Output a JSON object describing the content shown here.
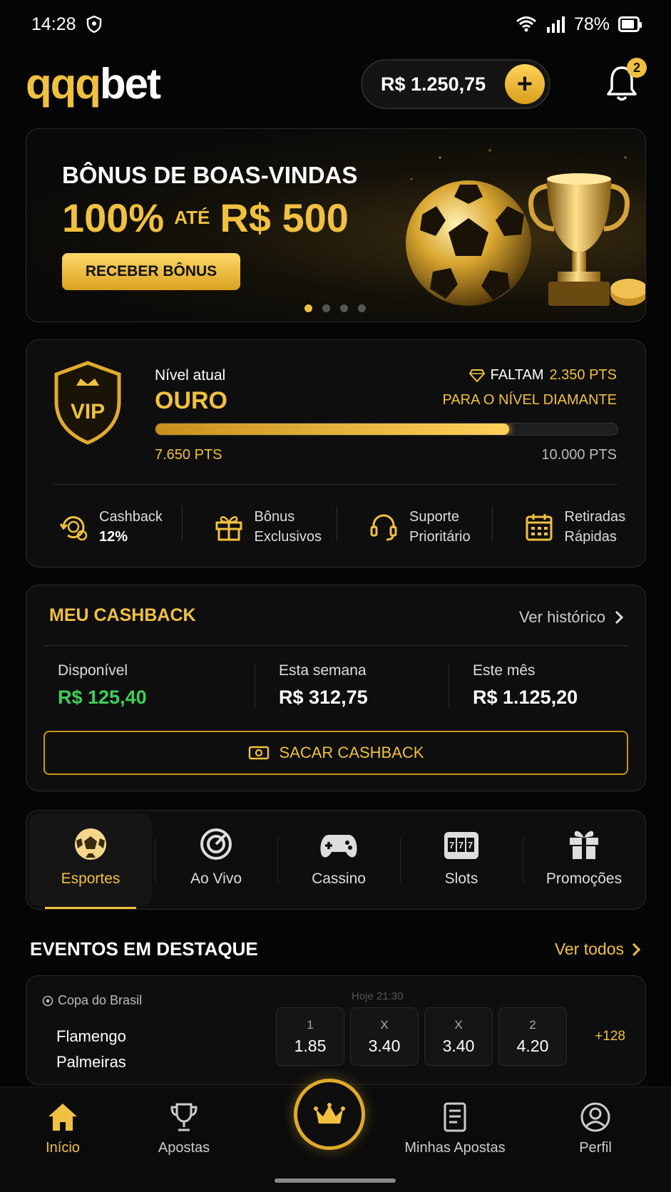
{
  "status": {
    "time": "14:28",
    "battery": "78%"
  },
  "header": {
    "logo_q": "qqq",
    "logo_bet": "bet",
    "balance": "R$ 1.250,75",
    "add_label": "+",
    "notif_count": "2"
  },
  "banner": {
    "title": "BÔNUS DE BOAS-VINDAS",
    "percent": "100%",
    "ate": "ATÉ",
    "amount": "R$ 500",
    "button": "RECEBER BÔNUS",
    "slides": 4,
    "active_slide": 0
  },
  "vip": {
    "badge": "VIP",
    "level_label": "Nível atual",
    "level": "OURO",
    "need_prefix": "FALTAM",
    "need_points": "2.350 PTS",
    "need_suffix": "PARA O NÍVEL DIAMANTE",
    "progress": 0.765,
    "current_pts": "7.650 PTS",
    "max_pts": "10.000 PTS",
    "perks": [
      {
        "icon": "cashback-icon",
        "line1": "Cashback",
        "line2": "12%"
      },
      {
        "icon": "gift-icon",
        "line1": "Bônus",
        "line2": "Exclusivos"
      },
      {
        "icon": "headset-icon",
        "line1": "Suporte",
        "line2": "Prioritário"
      },
      {
        "icon": "calendar-icon",
        "line1": "Retiradas",
        "line2": "Rápidas"
      }
    ]
  },
  "cashback": {
    "title": "MEU CASHBACK",
    "history": "Ver histórico",
    "available_label": "Disponível",
    "available": "R$ 125,40",
    "week_label": "Esta semana",
    "week": "R$ 312,75",
    "month_label": "Este mês",
    "month": "R$ 1.125,20",
    "button": "SACAR CASHBACK"
  },
  "categories": [
    {
      "icon": "soccer-ball-icon",
      "label": "Esportes",
      "active": true
    },
    {
      "icon": "target-icon",
      "label": "Ao Vivo"
    },
    {
      "icon": "gamepad-icon",
      "label": "Cassino"
    },
    {
      "icon": "slot-machine-icon",
      "label": "Slots"
    },
    {
      "icon": "gift-icon",
      "label": "Promoções"
    }
  ],
  "events": {
    "title": "EVENTOS EM DESTAQUE",
    "see_all": "Ver todos",
    "items": [
      {
        "league": "Copa do Brasil",
        "time": "Hoje 21:30",
        "home": "Flamengo",
        "away": "Palmeiras",
        "odds": [
          {
            "k": "1",
            "v": "1.85"
          },
          {
            "k": "X",
            "v": "3.40"
          },
          {
            "k": "X",
            "v": "3.40"
          },
          {
            "k": "2",
            "v": "4.20"
          }
        ],
        "more": "+128"
      }
    ]
  },
  "nav": {
    "home": "Início",
    "bets": "Apostas",
    "mybets": "Minhas Apostas",
    "profile": "Perfil"
  },
  "colors": {
    "accent": "#f0c040",
    "positive": "#3ecf5a",
    "background": "#050505"
  }
}
